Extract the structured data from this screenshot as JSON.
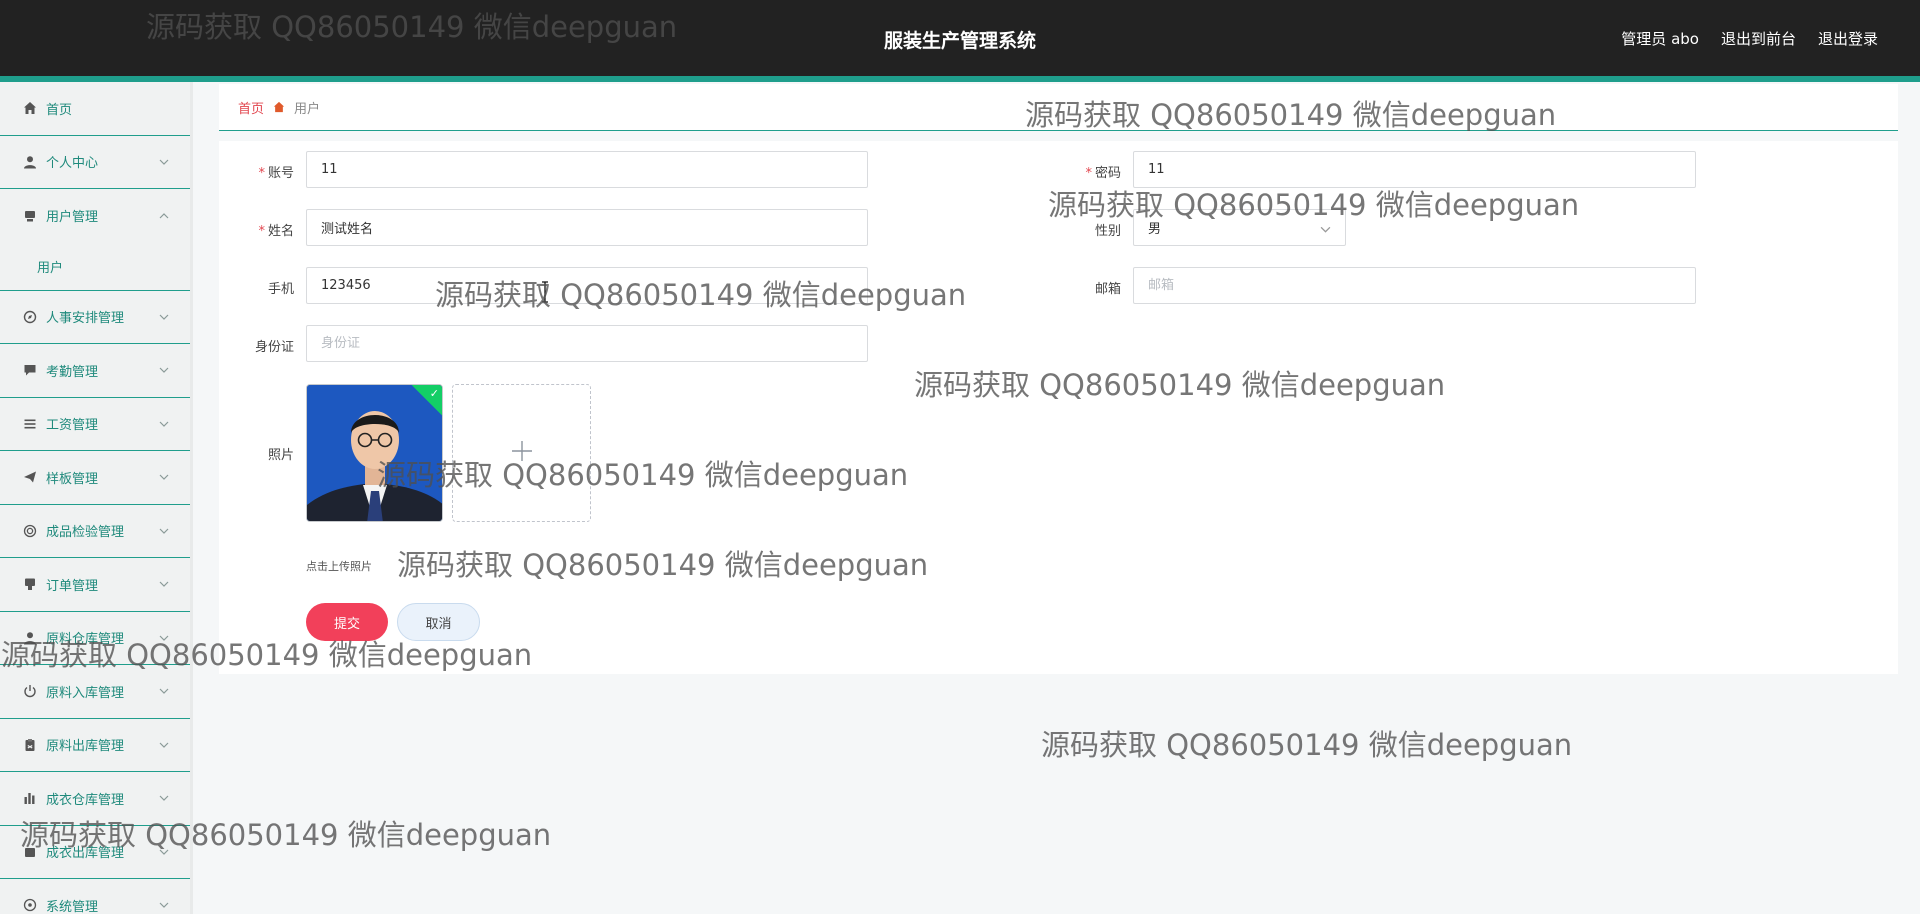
{
  "header": {
    "title": "服装生产管理系统",
    "admin_label": "管理员 abo",
    "front_link": "退出到前台",
    "logout_link": "退出登录"
  },
  "sidebar": {
    "items": [
      {
        "label": "首页",
        "icon": "home-icon",
        "expandable": false
      },
      {
        "label": "个人中心",
        "icon": "user-icon",
        "expandable": true
      },
      {
        "label": "用户管理",
        "icon": "user-manage-icon",
        "expandable": true,
        "expanded": true,
        "children": [
          "用户"
        ]
      },
      {
        "label": "人事安排管理",
        "icon": "compass-icon",
        "expandable": true
      },
      {
        "label": "考勤管理",
        "icon": "chat-icon",
        "expandable": true
      },
      {
        "label": "工资管理",
        "icon": "list-icon",
        "expandable": true
      },
      {
        "label": "样板管理",
        "icon": "send-icon",
        "expandable": true
      },
      {
        "label": "成品检验管理",
        "icon": "target-icon",
        "expandable": true
      },
      {
        "label": "订单管理",
        "icon": "order-icon",
        "expandable": true
      },
      {
        "label": "原料仓库管理",
        "icon": "warehouse-icon",
        "expandable": true
      },
      {
        "label": "原料入库管理",
        "icon": "power-icon",
        "expandable": true
      },
      {
        "label": "原料出库管理",
        "icon": "clipboard-icon",
        "expandable": true
      },
      {
        "label": "成衣仓库管理",
        "icon": "bar-chart-icon",
        "expandable": true
      },
      {
        "label": "成衣出库管理",
        "icon": "box-icon",
        "expandable": true
      },
      {
        "label": "系统管理",
        "icon": "settings-icon",
        "expandable": true
      }
    ]
  },
  "breadcrumb": {
    "home": "首页",
    "current": "用户"
  },
  "form": {
    "account": {
      "label": "账号",
      "value": "11",
      "required": true
    },
    "password": {
      "label": "密码",
      "value": "11",
      "required": true
    },
    "name": {
      "label": "姓名",
      "value": "测试姓名",
      "required": true
    },
    "gender": {
      "label": "性别",
      "value": "男"
    },
    "phone": {
      "label": "手机",
      "value": "123456"
    },
    "email": {
      "label": "邮箱",
      "value": "",
      "placeholder": "邮箱"
    },
    "id_card": {
      "label": "身份证",
      "value": "",
      "placeholder": "身份证"
    },
    "photo": {
      "label": "照片",
      "upload_hint": "点击上传照片"
    },
    "submit_label": "提交",
    "cancel_label": "取消"
  },
  "watermark_text": "源码获取 QQ86050149 微信deepguan",
  "colors": {
    "accent": "#1f9e8c",
    "header_bg": "#222222",
    "danger": "#f2405a",
    "success": "#13ce66"
  }
}
